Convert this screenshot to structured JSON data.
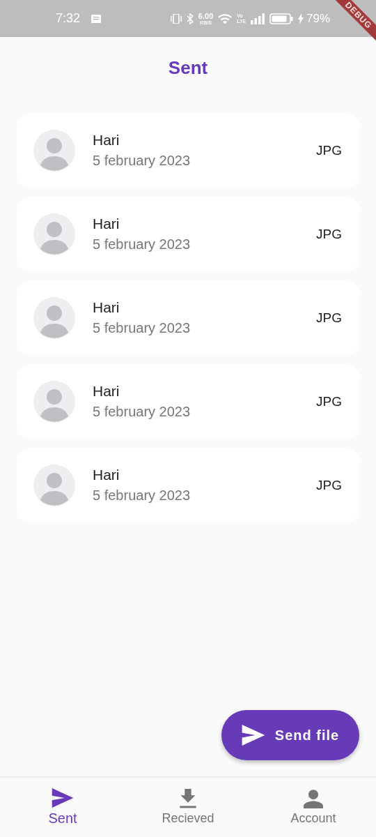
{
  "status_bar": {
    "time": "7:32",
    "speed": "6.00",
    "speed_unit": "KB/S",
    "volte_top": "Vo",
    "volte_bottom": "LTE",
    "battery_level": "79%"
  },
  "debug_banner": "DEBUG",
  "title": "Sent",
  "items": [
    {
      "name": "Hari",
      "date": "5 february 2023",
      "type": "JPG"
    },
    {
      "name": "Hari",
      "date": "5 february 2023",
      "type": "JPG"
    },
    {
      "name": "Hari",
      "date": "5 february 2023",
      "type": "JPG"
    },
    {
      "name": "Hari",
      "date": "5 february 2023",
      "type": "JPG"
    },
    {
      "name": "Hari",
      "date": "5 february 2023",
      "type": "JPG"
    }
  ],
  "fab": {
    "label": "Send file"
  },
  "nav": [
    {
      "label": "Sent",
      "kind": "send",
      "selected": true
    },
    {
      "label": "Recieved",
      "kind": "download",
      "selected": false
    },
    {
      "label": "Account",
      "kind": "person",
      "selected": false
    }
  ]
}
